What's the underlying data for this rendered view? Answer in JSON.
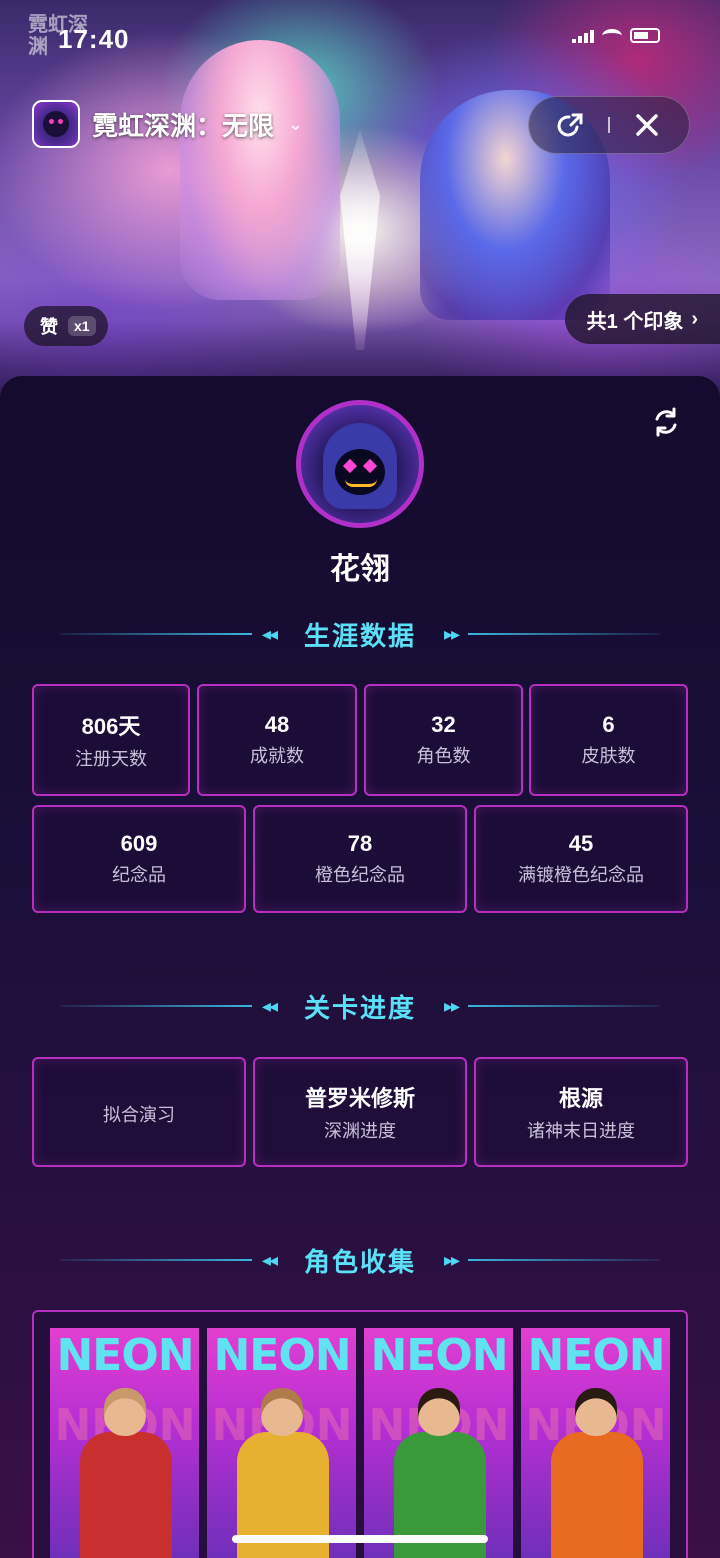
{
  "status_bar": {
    "time": "17:40",
    "game_mini_logo": "霓虹深渊"
  },
  "header": {
    "title": "霓虹深渊：无限",
    "chevron": "⌄"
  },
  "banner": {
    "like_label": "赞",
    "like_count": "x1",
    "impression_text": "共1 个印象",
    "impression_chevron": "›"
  },
  "profile": {
    "username": "花翎"
  },
  "sections": {
    "career": "生涯数据",
    "progress": "关卡进度",
    "roles": "角色收集"
  },
  "career_stats_row1": [
    {
      "value": "806天",
      "label": "注册天数"
    },
    {
      "value": "48",
      "label": "成就数"
    },
    {
      "value": "32",
      "label": "角色数"
    },
    {
      "value": "6",
      "label": "皮肤数"
    }
  ],
  "career_stats_row2": [
    {
      "value": "609",
      "label": "纪念品"
    },
    {
      "value": "78",
      "label": "橙色纪念品"
    },
    {
      "value": "45",
      "label": "满镀橙色纪念品"
    }
  ],
  "progress_stats": [
    {
      "value": "",
      "label": "拟合演习"
    },
    {
      "value": "普罗米修斯",
      "label": "深渊进度"
    },
    {
      "value": "根源",
      "label": "诸神末日进度"
    }
  ],
  "roles": [
    {
      "badge": "NEON",
      "icon": "character-gunner-icon",
      "hair": "#c89a6a",
      "outfit": "#c83030"
    },
    {
      "badge": "NEON",
      "icon": "character-ponytail-icon",
      "hair": "#b07a4a",
      "outfit": "#e8b030"
    },
    {
      "badge": "NEON",
      "icon": "character-brawler-icon",
      "hair": "#2a1a10",
      "outfit": "#3a9a3a"
    },
    {
      "badge": "NEON",
      "icon": "character-fighter-icon",
      "hair": "#2a1a14",
      "outfit": "#e86a20"
    }
  ],
  "colors": {
    "accent_cyan": "#5ce0f7",
    "box_border": "#b82fc0",
    "card_bg": "#1a0f38"
  }
}
